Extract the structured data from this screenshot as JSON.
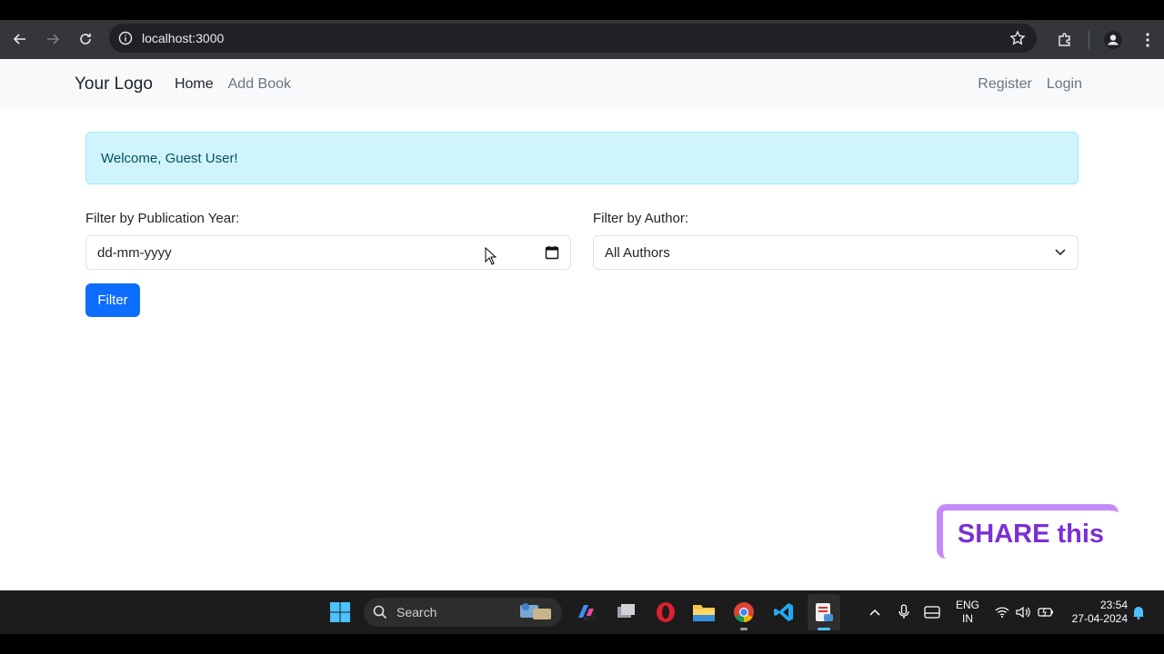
{
  "browser": {
    "url": "localhost:3000"
  },
  "navbar": {
    "brand": "Your Logo",
    "links": [
      "Home",
      "Add Book"
    ],
    "right_links": [
      "Register",
      "Login"
    ]
  },
  "alert": {
    "text": "Welcome, Guest User!"
  },
  "filters": {
    "year_label": "Filter by Publication Year:",
    "year_placeholder": "dd-mm-yyyy",
    "author_label": "Filter by Author:",
    "author_selected": "All Authors",
    "button_label": "Filter"
  },
  "overlay": {
    "share_text": "SHARE this"
  },
  "taskbar": {
    "search_label": "Search",
    "lang_line1": "ENG",
    "lang_line2": "IN",
    "time": "23:54",
    "date": "27-04-2024"
  },
  "colors": {
    "primary": "#0d6efd",
    "alert_bg": "#cff4fc",
    "share_text": "#7b2fd6"
  }
}
